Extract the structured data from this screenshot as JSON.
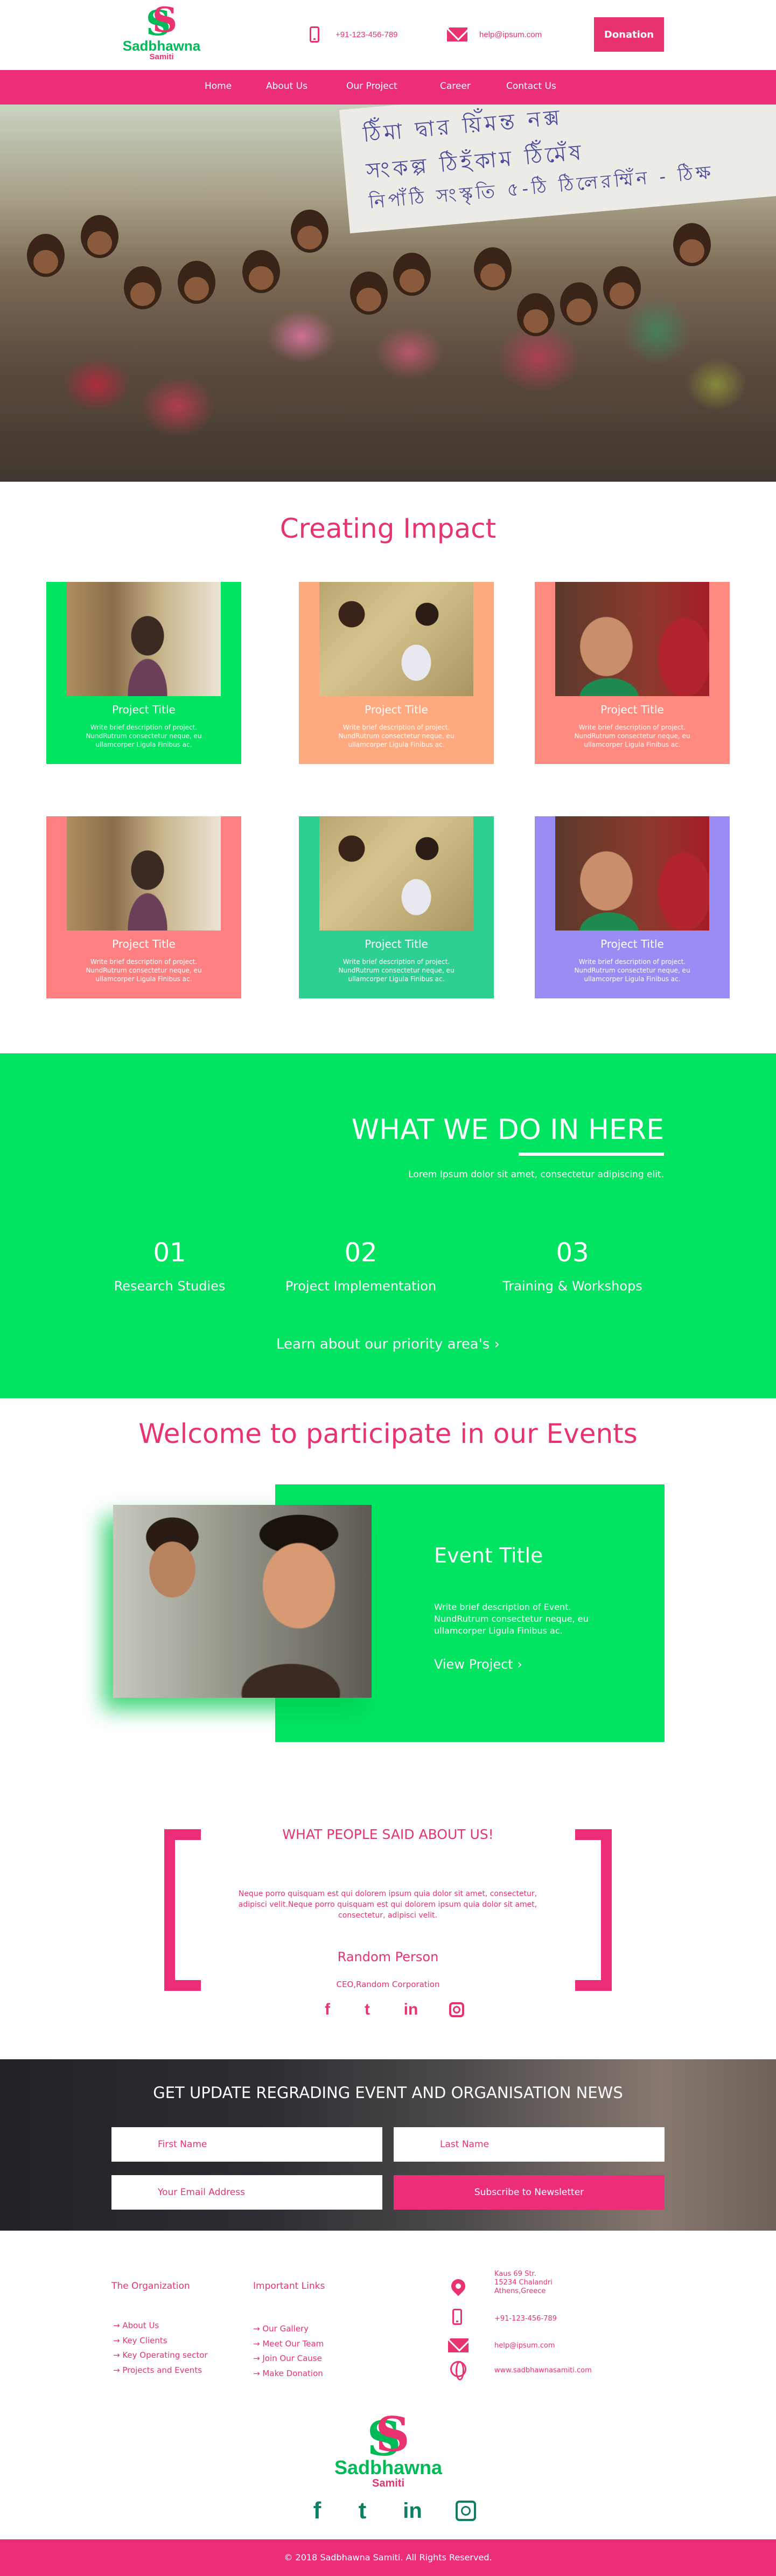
{
  "header": {
    "logo_mark": "S",
    "logo_name": "Sadbhawna",
    "logo_sub": "Samiti",
    "phone": "+91-123-456-789",
    "email": "help@ipsum.com",
    "donate_label": "Donation"
  },
  "nav": {
    "items": [
      "Home",
      "About Us",
      "Our Project",
      "Career",
      "Contact Us"
    ]
  },
  "hero": {
    "banner_lines": [
      "ঠিঁমা দ্বার য়িঁমন্ত নক্স",
      "সংকল্প ঠিহঁকাম ঠিঁমেঁষ",
      "নিপাঁঠি সংস্কৃতি ৫-ঠি ঠিলেরম্মিঁন - ঠিক্ষ"
    ]
  },
  "impact": {
    "title": "Creating Impact",
    "cards": [
      {
        "title": "Project Title",
        "desc": "Write brief description of project. NundRutrum consectetur neque, eu ullamcorper Ligula Finibus ac.",
        "bg": "#00e462",
        "img": "girl"
      },
      {
        "title": "Project Title",
        "desc": "Write brief description of project. NundRutrum consectetur neque, eu ullamcorper Ligula Finibus ac.",
        "bg": "#ffa981",
        "img": "play"
      },
      {
        "title": "Project Title",
        "desc": "Write brief description of project. NundRutrum consectetur neque, eu ullamcorper Ligula Finibus ac.",
        "bg": "#ff8a80",
        "img": "baby"
      },
      {
        "title": "Project Title",
        "desc": "Write brief description of project. NundRutrum consectetur neque, eu ullamcorper Ligula Finibus ac.",
        "bg": "#ff8080",
        "img": "girl"
      },
      {
        "title": "Project Title",
        "desc": "Write brief description of project. NundRutrum consectetur neque, eu ullamcorper Ligula Finibus ac.",
        "bg": "#2ed091",
        "img": "play"
      },
      {
        "title": "Project Title",
        "desc": "Write brief description of project. NundRutrum consectetur neque, eu ullamcorper Ligula Finibus ac.",
        "bg": "#9a8cf5",
        "img": "baby"
      }
    ]
  },
  "what": {
    "title": "WHAT WE DO IN HERE",
    "subtitle": "Lorem Ipsum dolor sit amet, consectetur adipiscing elit.",
    "steps": [
      {
        "num": "01",
        "label": "Research Studies"
      },
      {
        "num": "02",
        "label": "Project Implementation"
      },
      {
        "num": "03",
        "label": "Training & Workshops"
      }
    ],
    "learn_more": "Learn about our priority area's ›"
  },
  "events": {
    "title": "Welcome to participate in our Events",
    "event_title": "Event Title",
    "event_desc": "Write brief description of Event. NundRutrum consectetur neque, eu ullamcorper Ligula Finibus ac.",
    "view_label": "View Project ›"
  },
  "testimonial": {
    "title": "WHAT PEOPLE SAID ABOUT US!",
    "quote": "Neque porro quisquam est qui dolorem ipsum quia dolor sit amet, consectetur, adipisci velit.Neque porro quisquam est qui dolorem ipsum quia dolor sit amet, consectetur, adipisci velit.",
    "name": "Random Person",
    "role": "CEO,Random Corporation"
  },
  "newsletter": {
    "title": "GET UPDATE REGRADING EVENT AND ORGANISATION NEWS",
    "first_name": "First Name",
    "last_name": "Last Name",
    "email": "Your Email Address",
    "subscribe": "Subscribe to Newsletter"
  },
  "footer": {
    "org_title": "The Organization",
    "org_links": [
      "→ About Us",
      "→ Key Clients",
      "→ Key Operating sector",
      "→ Projects and Events"
    ],
    "links_title": "Important Links",
    "important_links": [
      "→ Our Gallery",
      "→ Meet Our Team",
      "→ Join Our Cause",
      "→ Make Donation"
    ],
    "address": [
      "Kaus 69 Str.",
      "15234 Chalandri",
      "Athens,Greece"
    ],
    "phone": "+91-123-456-789",
    "email": "help@ipsum.com",
    "website": "www.sadbhawnasamiti.com",
    "logo_mark": "S",
    "logo_name": "Sadbhawna",
    "logo_sub": "Samiti",
    "copyright": "© 2018 Sadbhawna Samiti. All Rights Reserved."
  },
  "social": {
    "icons": [
      "facebook-icon",
      "twitter-icon",
      "linkedin-icon",
      "instagram-icon"
    ],
    "glyphs": [
      "f",
      "t",
      "in",
      "◎"
    ]
  },
  "colors": {
    "brand_pink": "#ec2d78",
    "brand_green": "#00e462",
    "logo_green": "#00b957",
    "footer_icon_green": "#0f7f63"
  }
}
